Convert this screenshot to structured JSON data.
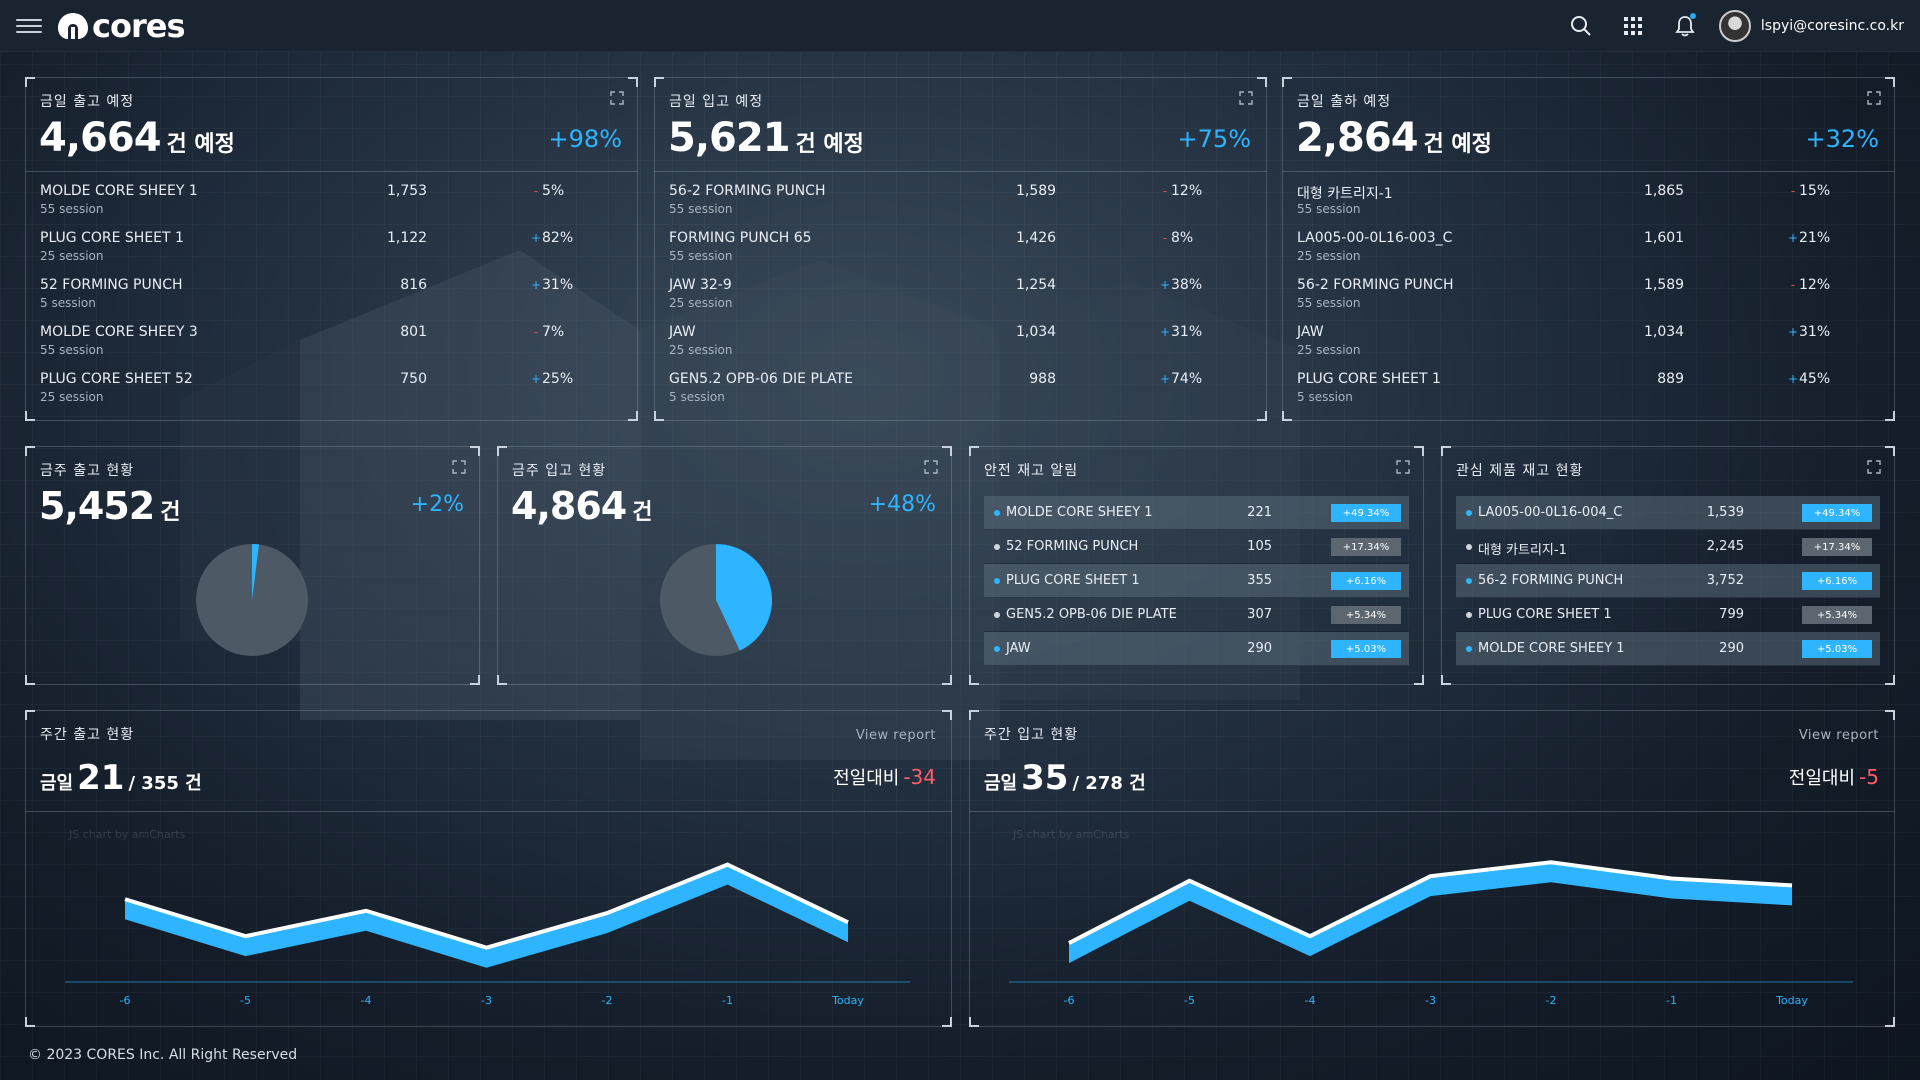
{
  "app": {
    "logo_text": "cores",
    "user_email": "lspyi@coresinc.co.kr"
  },
  "colors": {
    "accent": "#2fb4ff",
    "negative": "#ff5c6c",
    "pie_base": "#4d5965",
    "badge_gray": "#5c6670"
  },
  "outbound_today": {
    "title": "금일 출고 예정",
    "count": "4,664",
    "unit": "건 예정",
    "change": "+98%",
    "rows": [
      {
        "name": "MOLDE CORE SHEEY 1",
        "session": "55 session",
        "value": "1,753",
        "dir": "down",
        "change": "5%"
      },
      {
        "name": "PLUG CORE SHEET 1",
        "session": "25 session",
        "value": "1,122",
        "dir": "up",
        "change": "82%"
      },
      {
        "name": "52 FORMING PUNCH",
        "session": "5 session",
        "value": "816",
        "dir": "up",
        "change": "31%"
      },
      {
        "name": "MOLDE CORE SHEEY 3",
        "session": "55 session",
        "value": "801",
        "dir": "down",
        "change": "7%"
      },
      {
        "name": "PLUG CORE SHEET 52",
        "session": "25 session",
        "value": "750",
        "dir": "up",
        "change": "25%"
      }
    ]
  },
  "inbound_today": {
    "title": "금일 입고 예정",
    "count": "5,621",
    "unit": "건 예정",
    "change": "+75%",
    "rows": [
      {
        "name": "56-2 FORMING PUNCH",
        "session": "55 session",
        "value": "1,589",
        "dir": "down",
        "change": "12%"
      },
      {
        "name": "FORMING PUNCH 65",
        "session": "55 session",
        "value": "1,426",
        "dir": "down",
        "change": "8%"
      },
      {
        "name": "JAW 32-9",
        "session": "25 session",
        "value": "1,254",
        "dir": "up",
        "change": "38%"
      },
      {
        "name": "JAW",
        "session": "25 session",
        "value": "1,034",
        "dir": "up",
        "change": "31%"
      },
      {
        "name": "GEN5.2 OPB-06 DIE PLATE",
        "session": "5 session",
        "value": "988",
        "dir": "up",
        "change": "74%"
      }
    ]
  },
  "shipment_today": {
    "title": "금일 출하 예정",
    "count": "2,864",
    "unit": "건 예정",
    "change": "+32%",
    "rows": [
      {
        "name": "대형 카트리지-1",
        "session": "55 session",
        "value": "1,865",
        "dir": "down",
        "change": "15%"
      },
      {
        "name": "LA005-00-0L16-003_C",
        "session": "25 session",
        "value": "1,601",
        "dir": "up",
        "change": "21%"
      },
      {
        "name": "56-2 FORMING PUNCH",
        "session": "55 session",
        "value": "1,589",
        "dir": "down",
        "change": "12%"
      },
      {
        "name": "JAW",
        "session": "25 session",
        "value": "1,034",
        "dir": "up",
        "change": "31%"
      },
      {
        "name": "PLUG CORE SHEET 1",
        "session": "5 session",
        "value": "889",
        "dir": "up",
        "change": "45%"
      }
    ]
  },
  "week_outbound": {
    "title": "금주 출고 현황",
    "count": "5,452",
    "unit": "건",
    "change": "+2%",
    "pie_fraction": 0.02
  },
  "week_inbound": {
    "title": "금주 입고 현황",
    "count": "4,864",
    "unit": "건",
    "change": "+48%",
    "pie_fraction": 0.43
  },
  "safety_stock": {
    "title": "안전 재고 알림",
    "rows": [
      {
        "name": "MOLDE CORE SHEEY 1",
        "value": "221",
        "badge": "+49.34%",
        "color": "#2fb4ff"
      },
      {
        "name": "52 FORMING PUNCH",
        "value": "105",
        "badge": "+17.34%",
        "color": "#5c6670"
      },
      {
        "name": "PLUG CORE SHEET 1",
        "value": "355",
        "badge": "+6.16%",
        "color": "#2fb4ff"
      },
      {
        "name": "GEN5.2 OPB-06 DIE PLATE",
        "value": "307",
        "badge": "+5.34%",
        "color": "#5c6670"
      },
      {
        "name": "JAW",
        "value": "290",
        "badge": "+5.03%",
        "color": "#2fb4ff"
      }
    ]
  },
  "interest_stock": {
    "title": "관심 제품 재고 현황",
    "rows": [
      {
        "name": "LA005-00-0L16-004_C",
        "value": "1,539",
        "badge": "+49.34%",
        "color": "#2fb4ff"
      },
      {
        "name": "대형 카트리지-1",
        "value": "2,245",
        "badge": "+17.34%",
        "color": "#5c6670"
      },
      {
        "name": "56-2 FORMING PUNCH",
        "value": "3,752",
        "badge": "+6.16%",
        "color": "#2fb4ff"
      },
      {
        "name": "PLUG CORE SHEET 1",
        "value": "799",
        "badge": "+5.34%",
        "color": "#5c6670"
      },
      {
        "name": "MOLDE CORE SHEEY 1",
        "value": "290",
        "badge": "+5.03%",
        "color": "#2fb4ff"
      }
    ]
  },
  "weekly_out": {
    "title": "주간 출고 현황",
    "view_report": "View report",
    "prefix": "금일",
    "today": "21",
    "total": "/ 355",
    "unit": "건",
    "cmp_label": "전일대비",
    "cmp_value": "-34",
    "watermark": "JS chart by amCharts"
  },
  "weekly_in": {
    "title": "주간 입고 현황",
    "view_report": "View report",
    "prefix": "금일",
    "today": "35",
    "total": "/ 278",
    "unit": "건",
    "cmp_label": "전일대비",
    "cmp_value": "-5",
    "watermark": "JS chart by amCharts"
  },
  "chart_data": [
    {
      "type": "line",
      "categories": [
        "-6",
        "-5",
        "-4",
        "-3",
        "-2",
        "-1",
        "Today"
      ],
      "values": [
        70,
        38,
        60,
        28,
        58,
        100,
        50
      ],
      "ylim": [
        0,
        130
      ]
    },
    {
      "type": "line",
      "categories": [
        "-6",
        "-5",
        "-4",
        "-3",
        "-2",
        "-1",
        "Today"
      ],
      "values": [
        32,
        86,
        38,
        90,
        102,
        88,
        82
      ],
      "ylim": [
        0,
        130
      ]
    }
  ],
  "footer": "© 2023 CORES Inc. All Right Reserved"
}
